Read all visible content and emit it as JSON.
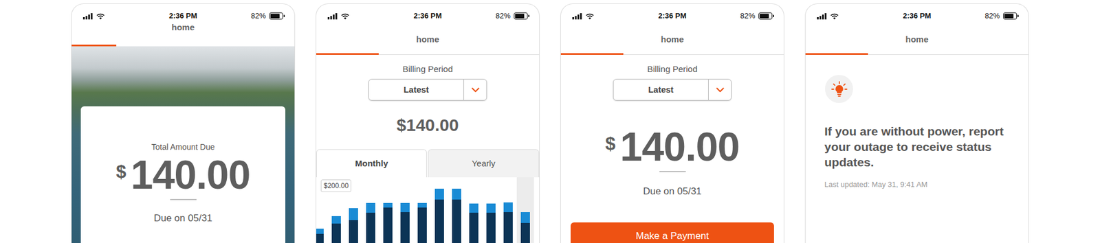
{
  "screens": [
    {
      "kind": "bill-summary",
      "status_bar": {
        "time": "2:36 PM",
        "battery": "82%",
        "battery_level": 0.82
      },
      "title": "home",
      "progress": 0.2,
      "amount_label": "Total Amount Due",
      "currency": "$",
      "amount": "140.00",
      "due": "Due on 05/31"
    },
    {
      "kind": "usage-chart",
      "status_bar": {
        "time": "2:36 PM",
        "battery": "82%",
        "battery_level": 0.82
      },
      "title": "home",
      "progress": 0.28,
      "billing_period_label": "Billing Period",
      "billing_period": "Latest",
      "amount": "$140.00",
      "tabs": [
        {
          "label": "Monthly",
          "selected": true
        },
        {
          "label": "Yearly",
          "selected": false
        }
      ],
      "chart": {
        "ticks": [
          {
            "label": "$200.00",
            "value": 200
          }
        ],
        "series": [
          {
            "color": "#0c3456",
            "values": [
              34,
              68,
              79,
              102,
              120,
              104,
              120,
              145,
              145,
              102,
              102,
              104,
              70
            ]
          },
          {
            "color": "#1a8bd5",
            "values": [
              18,
              23,
              39,
              32,
              14,
              30,
              14,
              34,
              34,
              30,
              30,
              32,
              34
            ]
          }
        ],
        "columns": [
          {
            "selected": false
          },
          {
            "selected": false
          },
          {
            "selected": false
          },
          {
            "selected": false
          },
          {
            "selected": false
          },
          {
            "selected": false
          },
          {
            "selected": false
          },
          {
            "selected": false
          },
          {
            "selected": false
          },
          {
            "selected": false
          },
          {
            "selected": false
          },
          {
            "selected": false
          },
          {
            "selected": true
          }
        ]
      }
    },
    {
      "kind": "payment",
      "status_bar": {
        "time": "2:36 PM",
        "battery": "82%",
        "battery_level": 0.82
      },
      "title": "home",
      "progress": 0.28,
      "billing_period_label": "Billing Period",
      "billing_period": "Latest",
      "currency": "$",
      "amount": "140.00",
      "due": "Due on 05/31",
      "button": "Make a Payment"
    },
    {
      "kind": "outage",
      "status_bar": {
        "time": "2:36 PM",
        "battery": "82%",
        "battery_level": 0.82
      },
      "title": "home",
      "progress": 0.28,
      "message": "If you are without power, report your outage to receive status updates.",
      "updated": "Last updated: May 31, 9:41 AM"
    }
  ]
}
